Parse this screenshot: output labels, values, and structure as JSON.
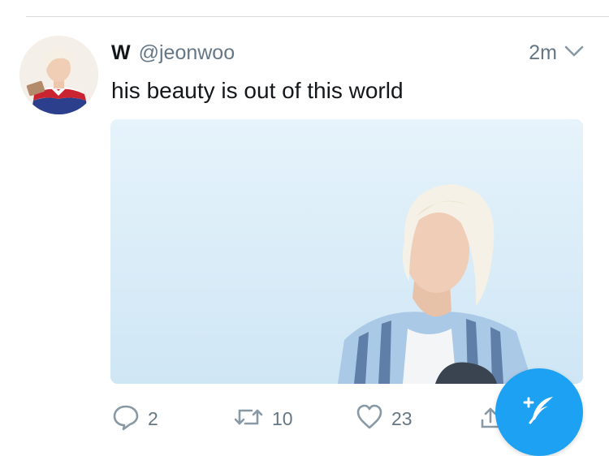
{
  "tweet": {
    "display_name": "W",
    "handle": "@jeonwoo",
    "timestamp": "2m",
    "text": "his beauty is out of this world"
  },
  "actions": {
    "replies": "2",
    "retweets": "10",
    "likes": "23"
  },
  "icons": {
    "reply": "reply-icon",
    "retweet": "retweet-icon",
    "like": "heart-icon",
    "share": "share-icon",
    "menu": "chevron-down-icon",
    "compose": "compose-tweet-icon"
  },
  "colors": {
    "accent": "#1da1f2",
    "secondary_text": "#657786",
    "primary_text": "#14171a"
  }
}
